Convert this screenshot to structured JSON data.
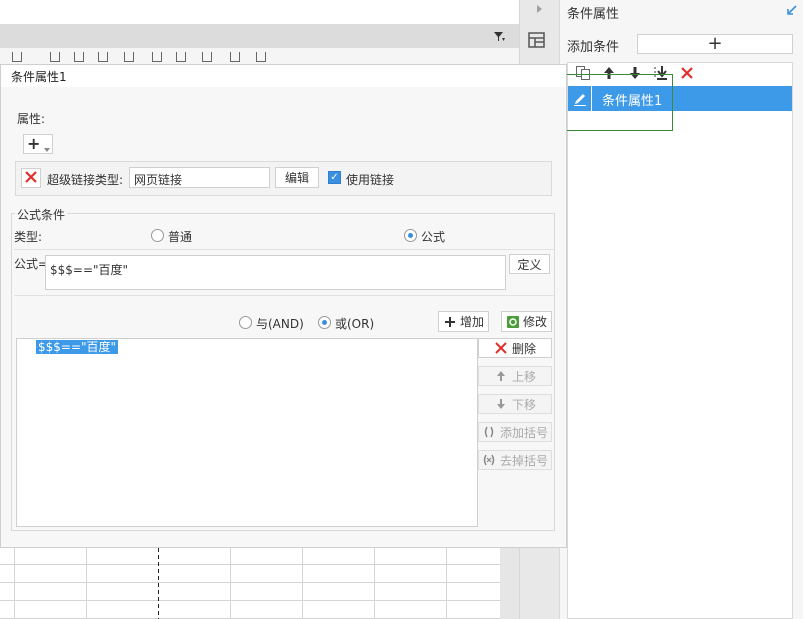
{
  "right_panel": {
    "title": "条件属性",
    "add_condition_label": "添加条件",
    "add_button_glyph": "+",
    "toolbar_icons": [
      "copy-icon",
      "arrow-up-icon",
      "arrow-down-icon",
      "move-to-bottom-icon",
      "delete-icon"
    ],
    "items": [
      {
        "label": "条件属性1",
        "icon": "pencil-icon",
        "selected": true
      }
    ]
  },
  "dialog": {
    "title": "条件属性1",
    "attribute": {
      "label": "属性:",
      "add_glyph": "+",
      "row": {
        "link_type_label": "超级链接类型:",
        "link_type_value": "网页链接",
        "edit_label": "编辑",
        "use_link_label": "使用链接",
        "use_link_checked": true
      }
    },
    "formula_condition": {
      "group_label": "公式条件",
      "type_label": "类型:",
      "type_options": [
        "普通",
        "公式"
      ],
      "type_selected": "公式",
      "formula_label": "公式=",
      "formula_value": "$$$==\"百度\"",
      "define_label": "定义",
      "logic_options": [
        "与(AND)",
        "或(OR)"
      ],
      "logic_selected": "或(OR)",
      "add_label": "增加",
      "modify_label": "修改",
      "conditions": [
        "$$$==\"百度\""
      ],
      "side_buttons": {
        "delete": "删除",
        "move_up": "上移",
        "move_down": "下移",
        "add_bracket": "添加括号",
        "remove_bracket": "去掉括号"
      }
    }
  },
  "colors": {
    "selection_blue": "#3d9ae8",
    "delete_red": "#e0302a",
    "highlight_green": "#3a8a3a"
  }
}
